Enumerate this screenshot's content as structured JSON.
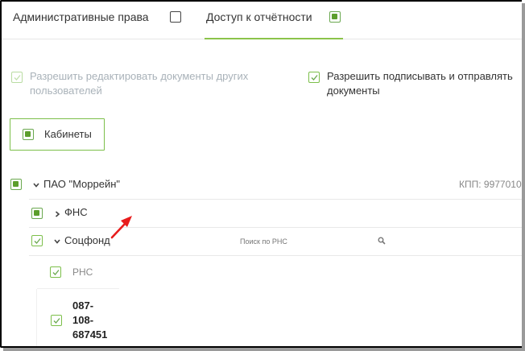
{
  "tabs": [
    {
      "label": "Административные права",
      "checked": false
    },
    {
      "label": "Доступ к отчётности",
      "checked": true,
      "active": true
    }
  ],
  "permissions": {
    "edit_docs_line1": "Разрешить редактировать документы других",
    "edit_docs_line2": "пользователей",
    "sign_send_line1": "Разрешить подписывать и отправлять",
    "sign_send_line2": "документы"
  },
  "cabinets": {
    "label": "Кабинеты"
  },
  "tree": {
    "org": {
      "label": "ПАО \"Моррейн\"",
      "kpp": "КПП: 9977010"
    },
    "fns": {
      "label": "ФНС"
    },
    "socfond": {
      "label": "Соцфонд",
      "search_placeholder": "Поиск по РНС"
    },
    "rns_header": "РНС",
    "rns_item": {
      "line1": "087-",
      "line2": "108-",
      "line3": "687451"
    }
  },
  "colors": {
    "accent": "#8bc34a",
    "checkbox_fill": "#5c9e2c",
    "annotation_arrow": "#e81c1c"
  }
}
